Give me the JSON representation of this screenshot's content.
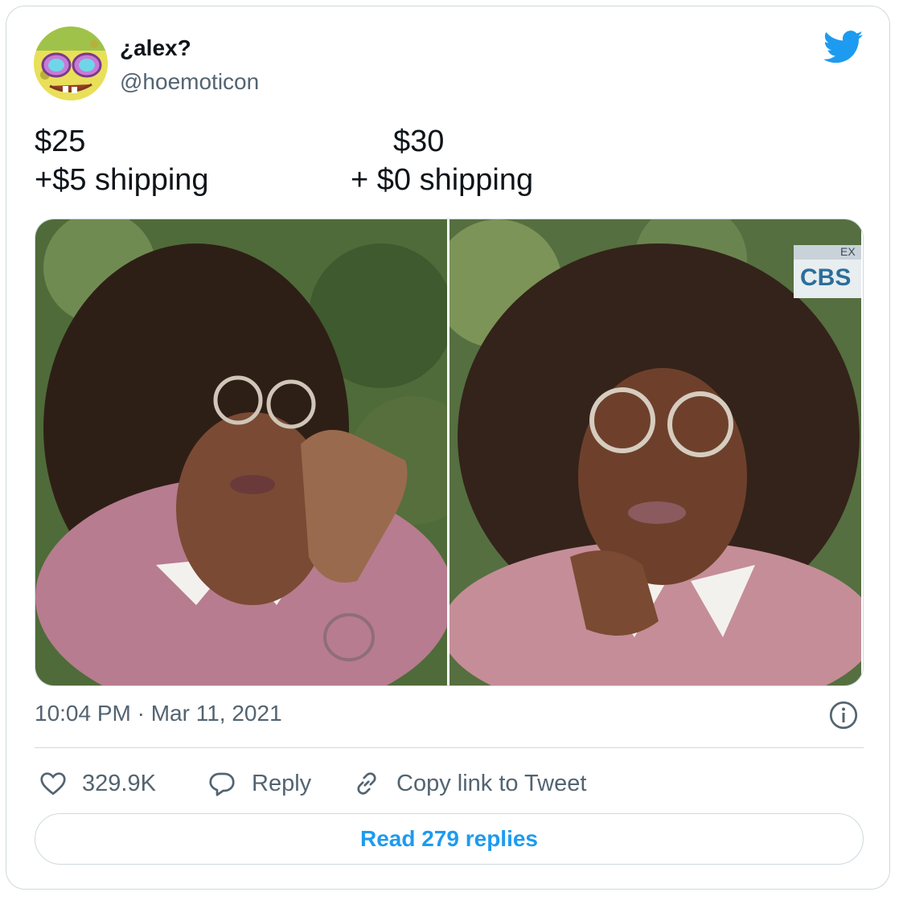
{
  "author": {
    "display_name": "¿alex?",
    "handle": "@hoemoticon",
    "avatar_icon": "spongebob-avatar"
  },
  "brand_icon": "twitter-bird-icon",
  "tweet": {
    "left_price": "$25",
    "left_shipping": "+$5 shipping",
    "right_price": "$30",
    "right_shipping": "+ $0 shipping"
  },
  "media": {
    "photo_count": 2,
    "watermark": "CBS",
    "badge_text": "EX"
  },
  "meta": {
    "timestamp": "10:04 PM · Mar 11, 2021"
  },
  "actions": {
    "likes": "329.9K",
    "reply": "Reply",
    "copy_link": "Copy link to Tweet"
  },
  "read_replies": "Read 279 replies",
  "colors": {
    "accent": "#1d9bf0",
    "text": "#0f1419",
    "secondary": "#536471",
    "border": "#cfd9de"
  }
}
